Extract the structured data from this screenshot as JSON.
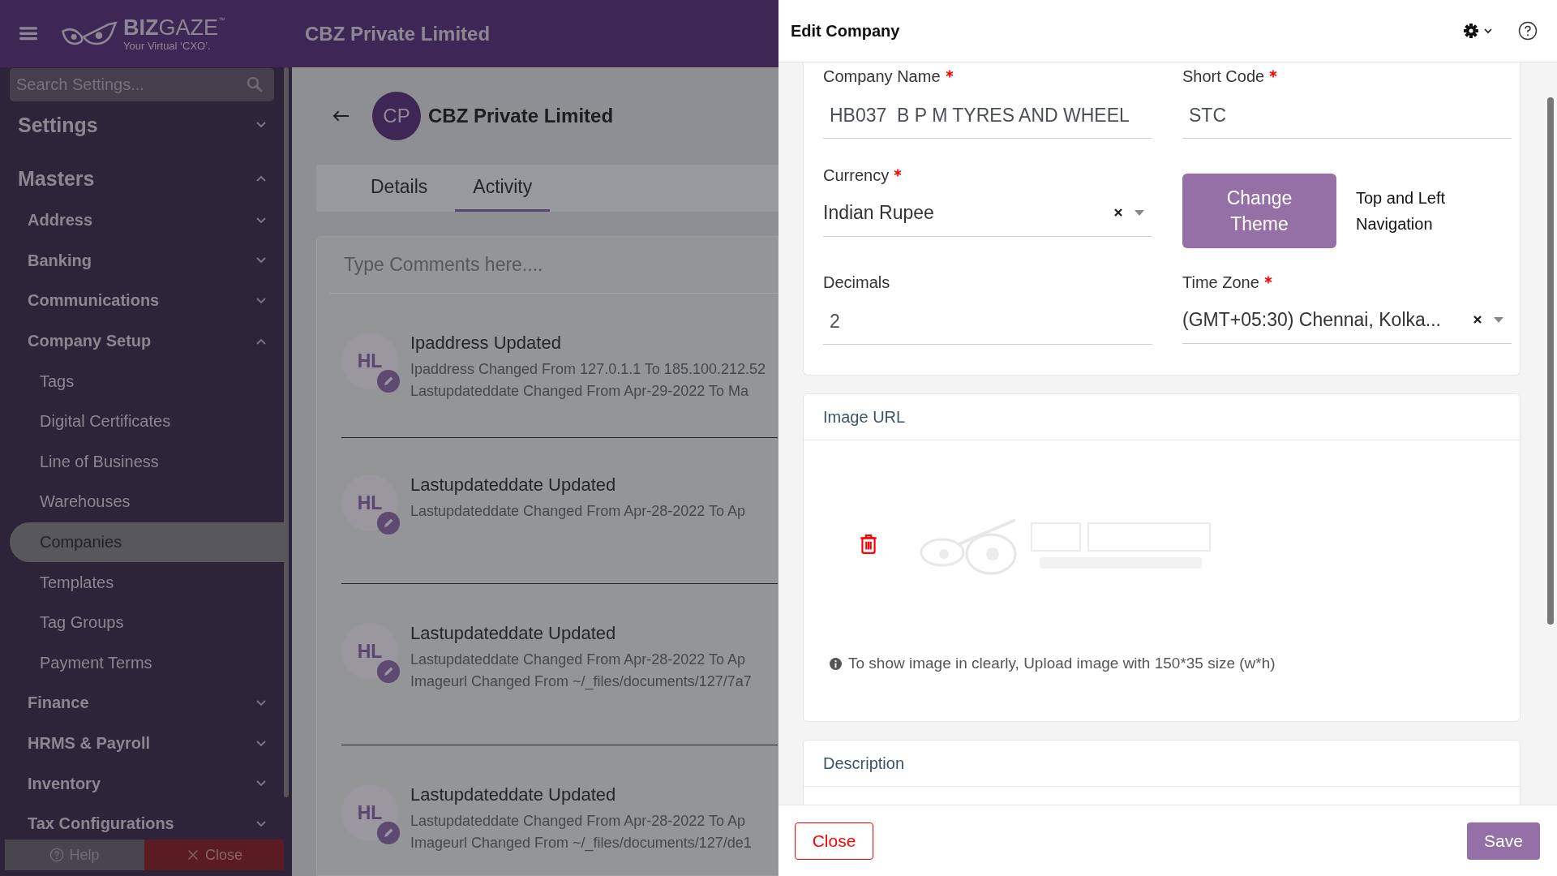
{
  "header": {
    "brand_bold": "BIZ",
    "brand": "GAZE",
    "brand_tm": "™",
    "tagline": "Your Virtual ‘CXO’.",
    "company": "CBZ Private Limited"
  },
  "sidebar": {
    "search": {
      "placeholder": "Search Settings..."
    },
    "items": [
      {
        "label": "Settings",
        "expanded": false,
        "selected": false
      },
      {
        "label": "Masters",
        "expanded": true,
        "selected": false,
        "children": [
          {
            "label": "Address",
            "expanded": false,
            "selected": false
          },
          {
            "label": "Banking",
            "expanded": false,
            "selected": false
          },
          {
            "label": "Communications",
            "expanded": false,
            "selected": false
          },
          {
            "label": "Company Setup",
            "expanded": true,
            "selected": false,
            "children": [
              {
                "label": "Tags",
                "selected": false
              },
              {
                "label": "Digital Certificates",
                "selected": false
              },
              {
                "label": "Line of Business",
                "selected": false
              },
              {
                "label": "Warehouses",
                "selected": false
              },
              {
                "label": "Companies",
                "selected": true
              },
              {
                "label": "Templates",
                "selected": false
              },
              {
                "label": "Tag Groups",
                "selected": false
              },
              {
                "label": "Payment Terms",
                "selected": false
              }
            ]
          },
          {
            "label": "Finance",
            "expanded": false,
            "selected": false
          },
          {
            "label": "HRMS & Payroll",
            "expanded": false,
            "selected": false
          },
          {
            "label": "Inventory",
            "expanded": false,
            "selected": false
          },
          {
            "label": "Tax Configurations",
            "expanded": false,
            "selected": false
          }
        ]
      }
    ],
    "help": "Help",
    "close": "Close"
  },
  "company": {
    "initials": "CP",
    "name": "CBZ Private Limited"
  },
  "tabs": [
    {
      "label": "Details",
      "selected": false
    },
    {
      "label": "Activity",
      "selected": true
    }
  ],
  "comment": {
    "placeholder": "Type Comments here...."
  },
  "activity": [
    {
      "initials": "HL",
      "title": "Ipaddress Updated",
      "lines": [
        "Ipaddress Changed From 127.0.1.1 To 185.100.212.52",
        "Lastupdateddate Changed From Apr-29-2022 To Ma"
      ]
    },
    {
      "initials": "HL",
      "title": "Lastupdateddate Updated",
      "lines": [
        "Lastupdateddate Changed From Apr-28-2022 To Ap"
      ]
    },
    {
      "initials": "HL",
      "title": "Lastupdateddate Updated",
      "lines": [
        "Lastupdateddate Changed From Apr-28-2022 To Ap",
        "Imageurl Changed From ~/_files/documents/127/7a7"
      ]
    },
    {
      "initials": "HL",
      "title": "Lastupdateddate Updated",
      "lines": [
        "Lastupdateddate Changed From Apr-28-2022 To Ap",
        "Imageurl Changed From ~/_files/documents/127/de1"
      ]
    }
  ],
  "panel": {
    "title": "Edit Company",
    "fields": [
      {
        "kind": "input",
        "label": "Company Name",
        "required": true,
        "value": "HB037  B P M TYRES AND WHEEL"
      },
      {
        "kind": "input",
        "label": "Short Code",
        "required": true,
        "value": "STC"
      },
      {
        "kind": "select",
        "label": "Currency",
        "required": true,
        "value": "Indian Rupee"
      },
      {
        "kind": "theme",
        "button": "Change Theme",
        "value": "Top and Left Navigation"
      },
      {
        "kind": "input",
        "label": "Decimals",
        "required": false,
        "value": "2"
      },
      {
        "kind": "select",
        "label": "Time Zone",
        "required": true,
        "value": "(GMT+05:30) Chennai, Kolka..."
      }
    ],
    "image_section": {
      "title": "Image URL",
      "hint": "To show image in clearly, Upload image with 150*35 size (w*h)"
    },
    "description_section": {
      "title": "Description"
    },
    "close": "Close",
    "save": "Save"
  }
}
